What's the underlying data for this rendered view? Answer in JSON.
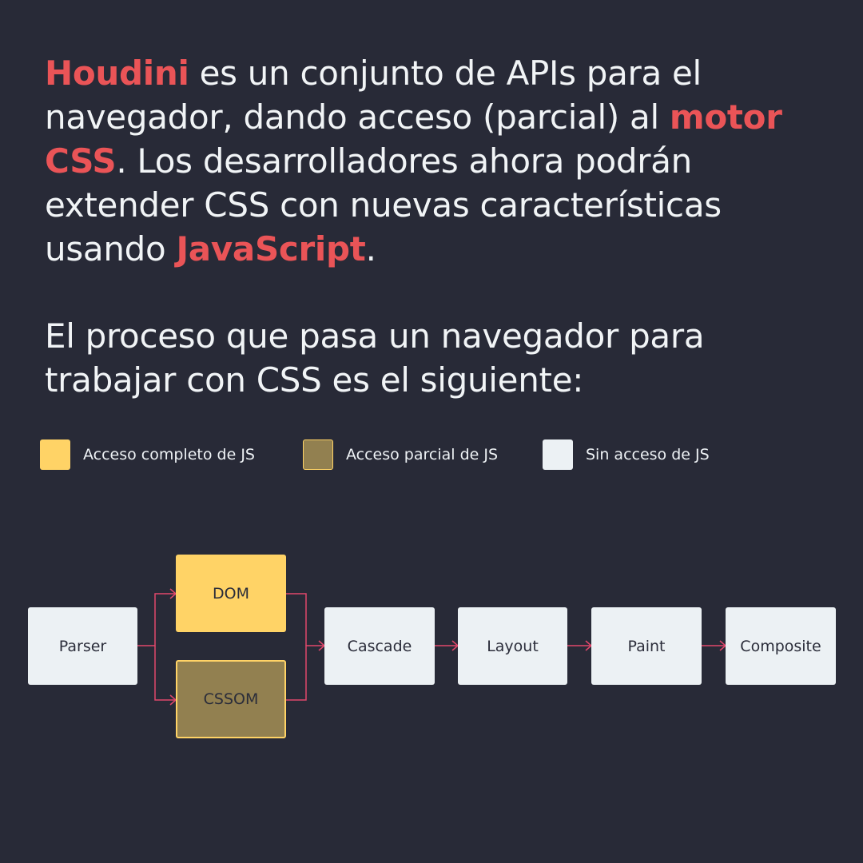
{
  "intro": {
    "part1": "Houdini",
    "part2": " es un conjunto de APIs para el navegador, dando acceso (parcial) al ",
    "part3": "motor CSS",
    "part4": ". Los desarrolladores ahora podrán extender CSS con nuevas características usando ",
    "part5": "JavaScript",
    "part6": "."
  },
  "process_text": "El proceso que pasa un navegador para trabajar con CSS es el siguiente:",
  "legend": {
    "full": "Acceso completo de JS",
    "partial": "Acceso parcial de JS",
    "none": "Sin acceso de JS"
  },
  "nodes": {
    "parser": "Parser",
    "dom": "DOM",
    "cssom": "CSSOM",
    "cascade": "Cascade",
    "layout": "Layout",
    "paint": "Paint",
    "composite": "Composite"
  },
  "colors": {
    "background": "#282a37",
    "highlight": "#ea5457",
    "full_access": "#ffd366",
    "partial_access": "#928050",
    "no_access": "#ecf1f4",
    "arrow": "#e1476b"
  }
}
